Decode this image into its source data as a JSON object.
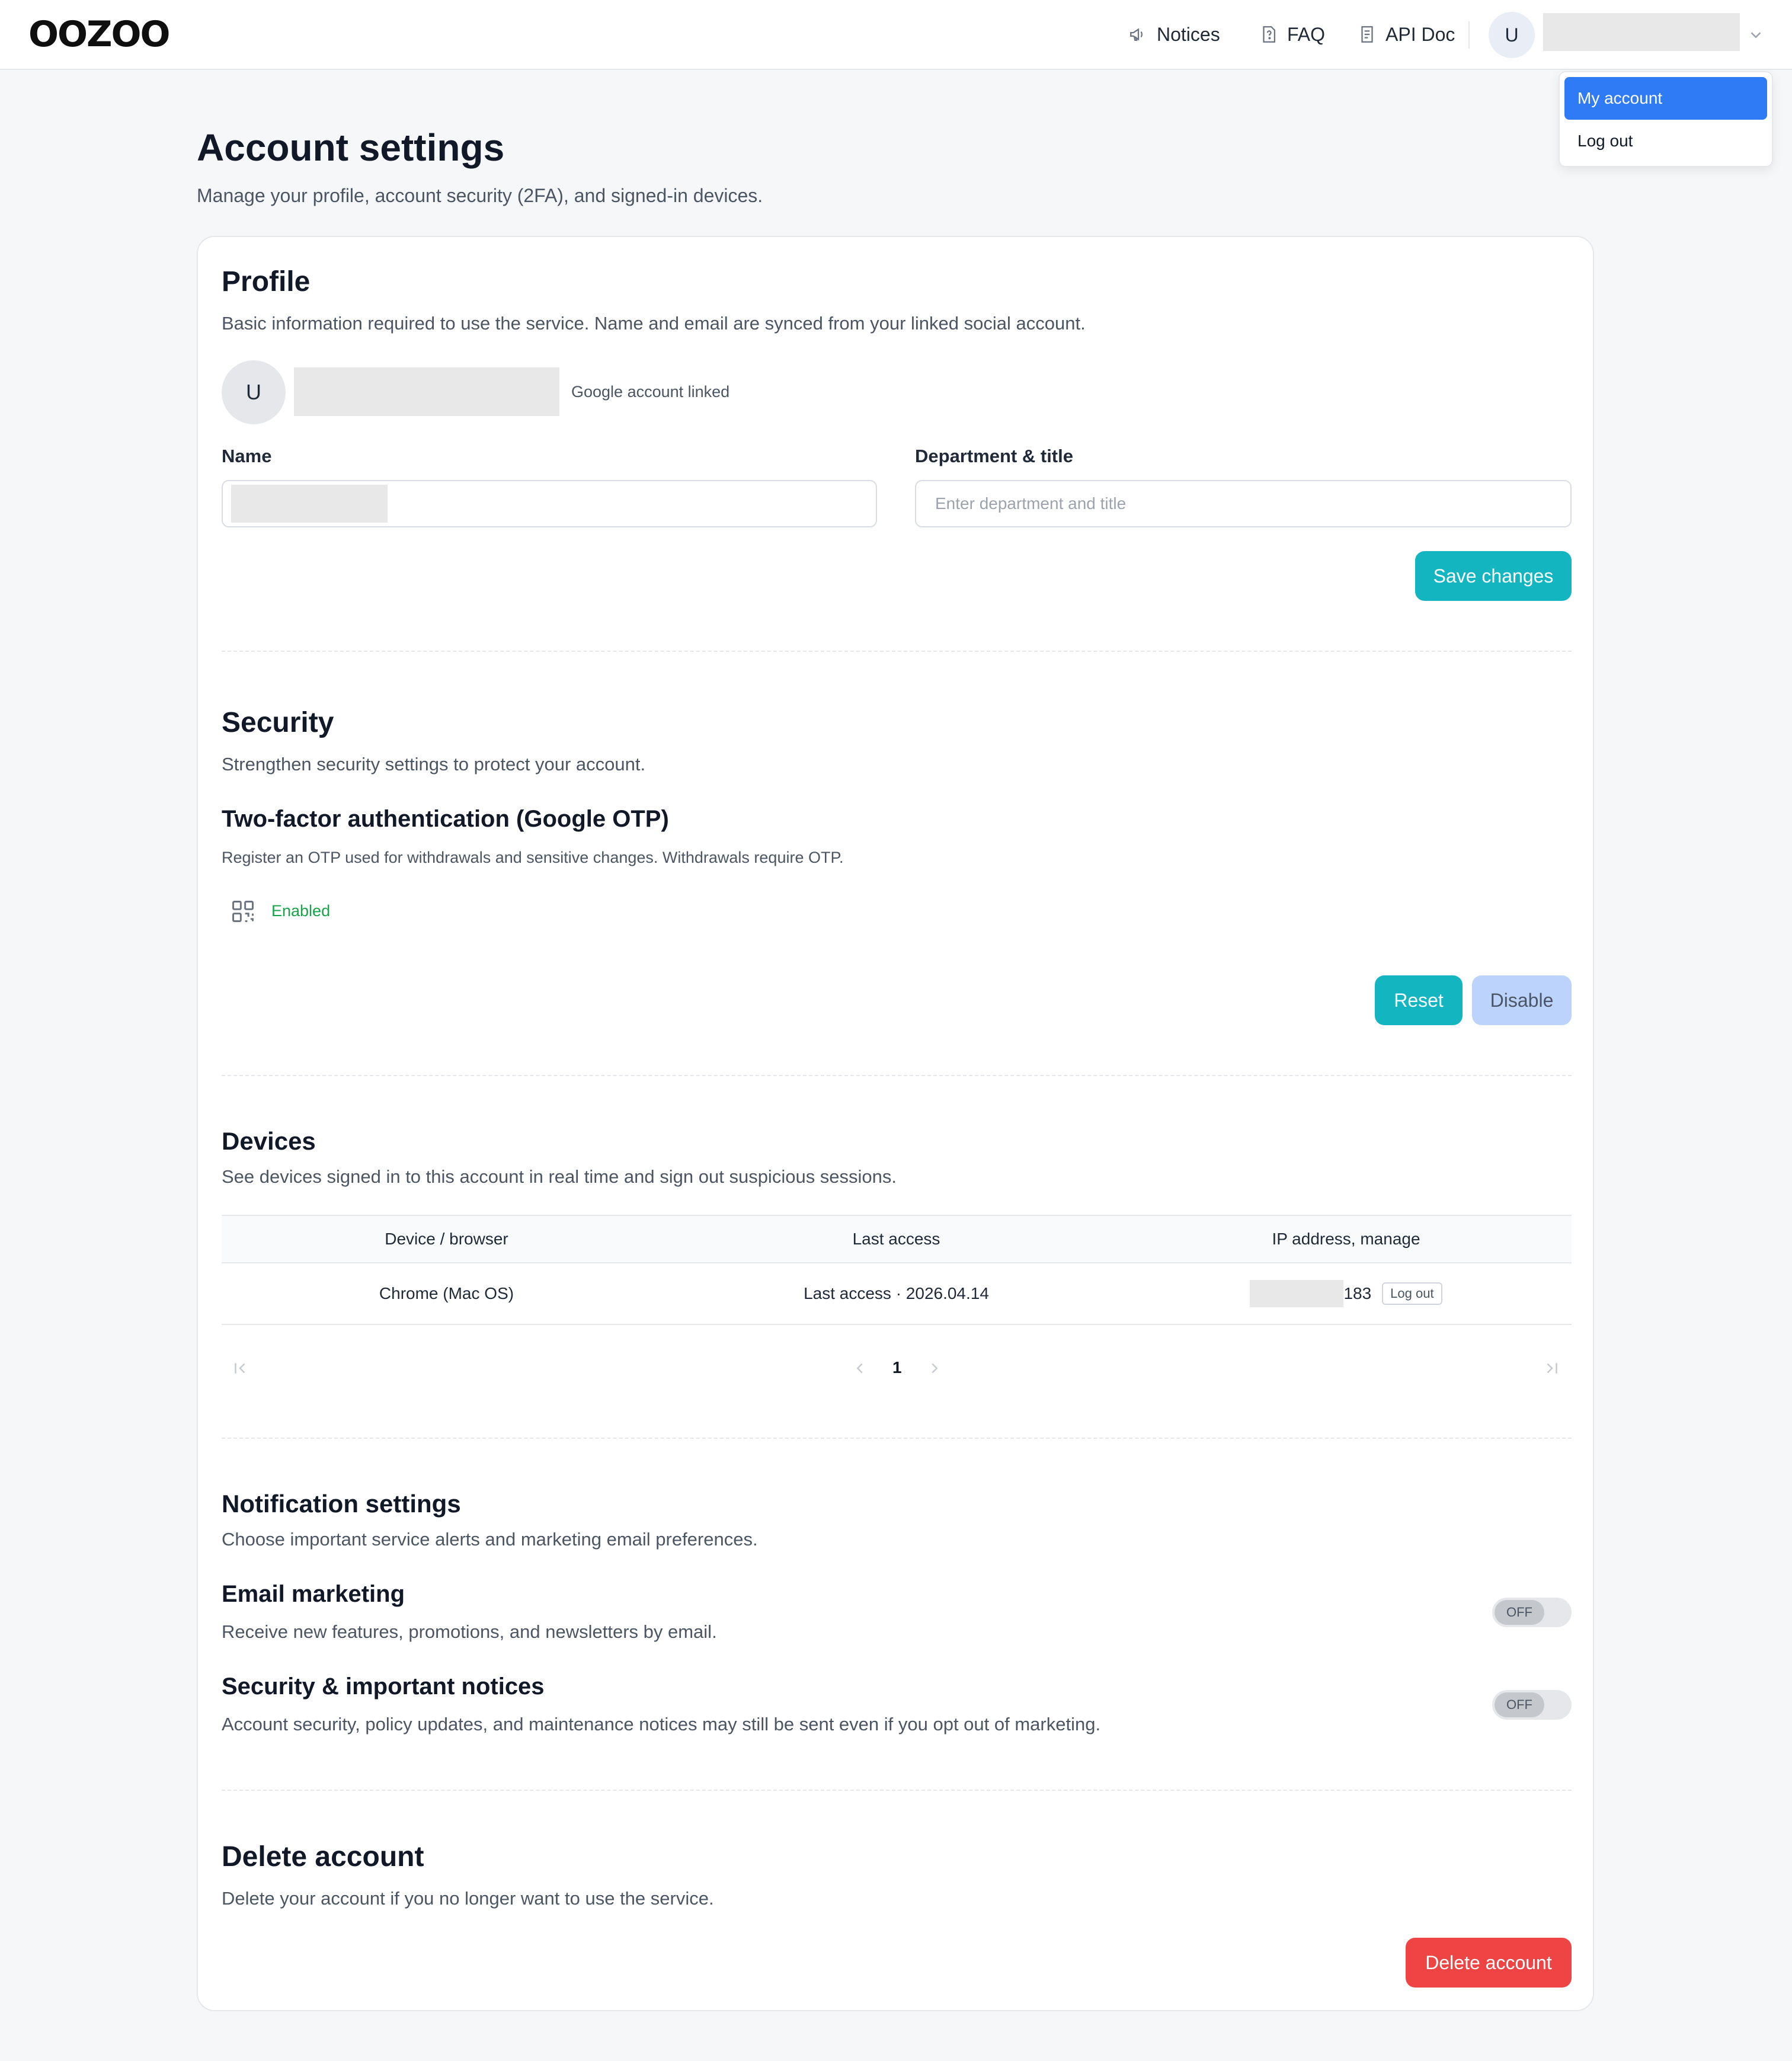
{
  "header": {
    "logo": "OOZOO",
    "nav": {
      "notices": "Notices",
      "faq": "FAQ",
      "api_doc": "API Doc"
    },
    "avatar_initial": "U"
  },
  "user_menu": {
    "items": [
      "My account",
      "Log out"
    ]
  },
  "page": {
    "title": "Account settings",
    "subtitle": "Manage your profile, account security (2FA), and signed-in devices."
  },
  "profile": {
    "title": "Profile",
    "description": "Basic information required to use the service. Name and email are synced from your linked social account.",
    "avatar_initial": "U",
    "linked_text": "Google account linked",
    "name_label": "Name",
    "department_label": "Department & title",
    "department_placeholder": "Enter department and title",
    "save_label": "Save changes"
  },
  "security": {
    "title": "Security",
    "description": "Strengthen security settings to protect your account.",
    "twofa_title": "Two-factor authentication (Google OTP)",
    "twofa_description": "Register an OTP used for withdrawals and sensitive changes. Withdrawals require OTP.",
    "status": "Enabled",
    "reset_label": "Reset",
    "disable_label": "Disable",
    "colors": {
      "enabled": "#16a34a"
    }
  },
  "devices": {
    "title": "Devices",
    "description": "See devices signed in to this account in real time and sign out suspicious sessions.",
    "columns": [
      "Device / browser",
      "Last access",
      "IP address, manage"
    ],
    "rows": [
      {
        "device": "Chrome (Mac OS)",
        "last_access": "Last access · 2026.04.14",
        "ip_suffix": "183",
        "action": "Log out"
      }
    ],
    "pagination": {
      "current_page": "1"
    }
  },
  "notifications": {
    "title": "Notification settings",
    "description": "Choose important service alerts and marketing email preferences.",
    "items": [
      {
        "title": "Email marketing",
        "description": "Receive new features, promotions, and newsletters by email.",
        "state": "OFF"
      },
      {
        "title": "Security & important notices",
        "description": "Account security, policy updates, and maintenance notices may still be sent even if you opt out of marketing.",
        "state": "OFF"
      }
    ]
  },
  "delete_account": {
    "title": "Delete account",
    "description": "Delete your account if you no longer want to use the service.",
    "button_label": "Delete account"
  },
  "colors": {
    "primary_teal": "#12b5c0",
    "accent_blue": "#2f7bf6",
    "danger_red": "#ef4444"
  }
}
